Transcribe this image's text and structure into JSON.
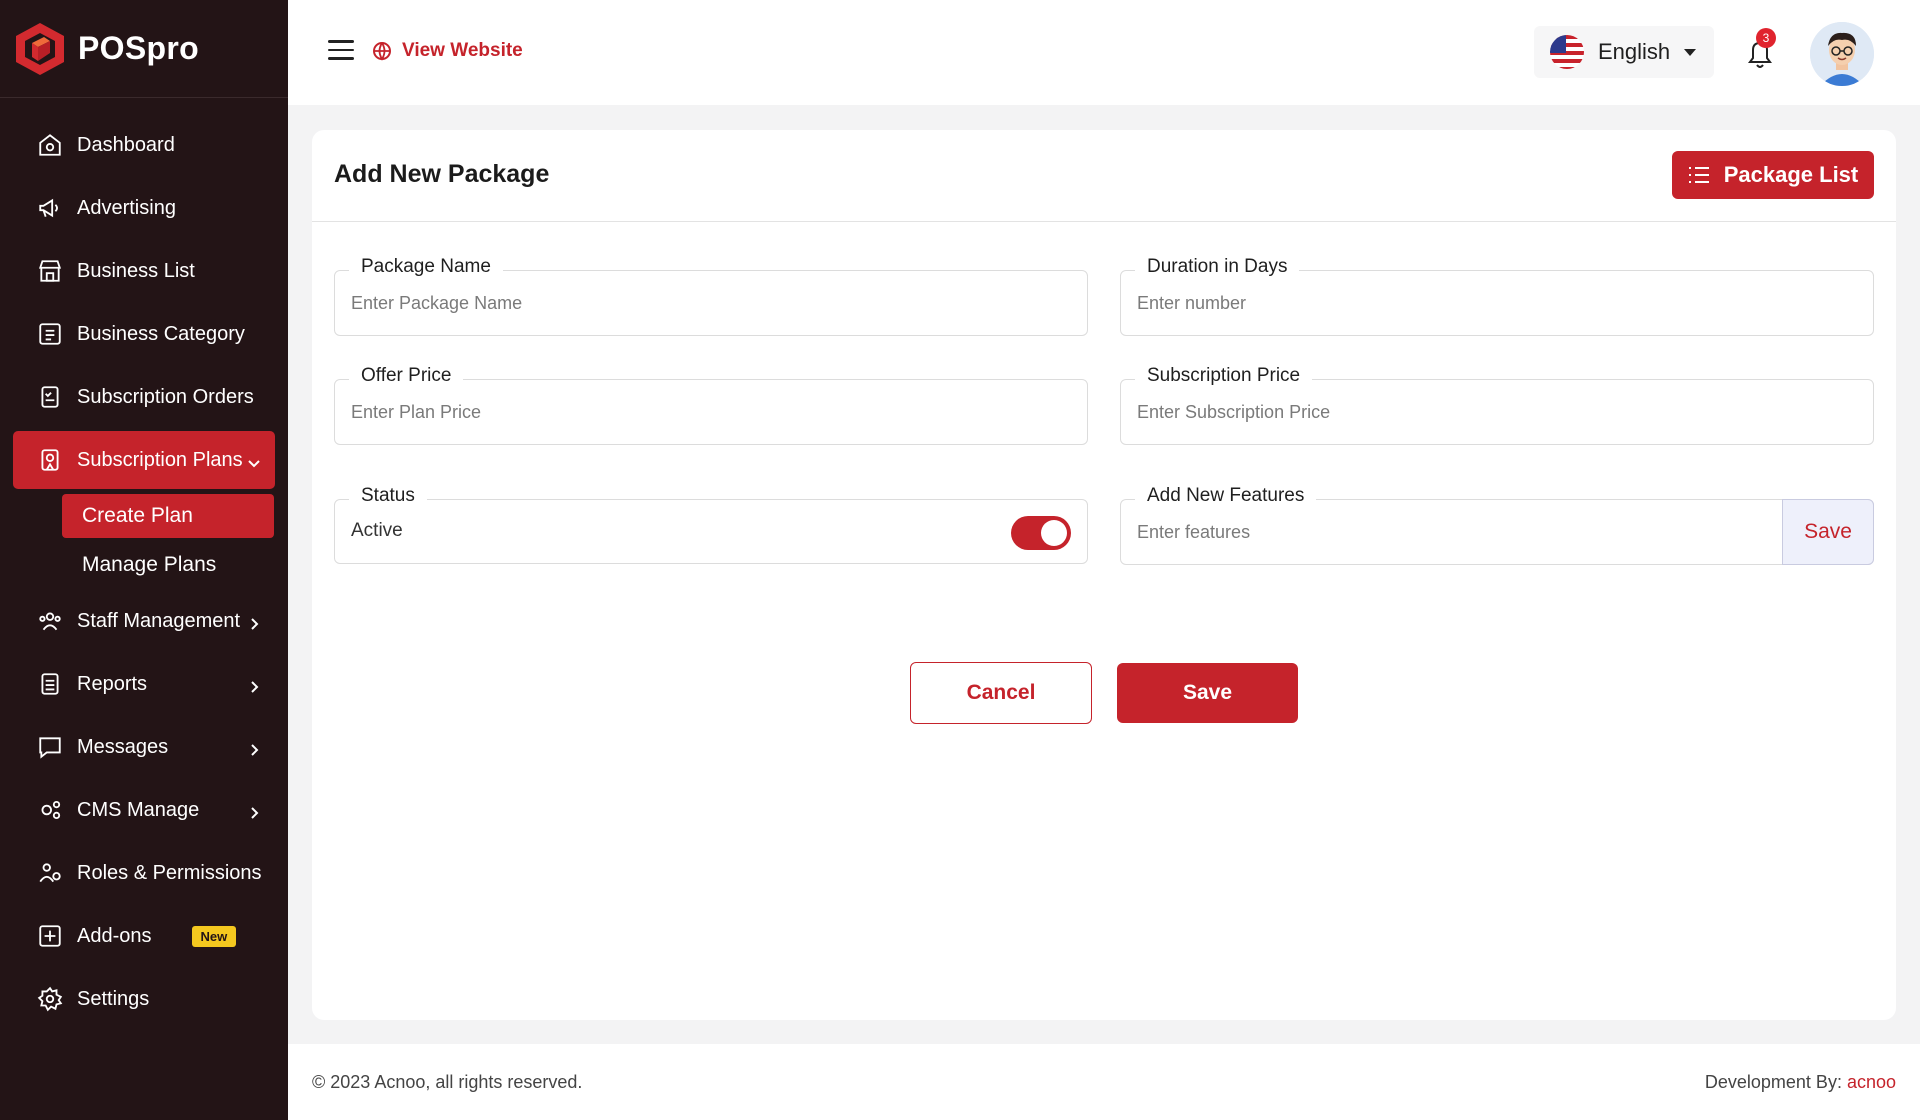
{
  "brand": {
    "name": "POSpro"
  },
  "sidebar": {
    "items": [
      {
        "label": "Dashboard",
        "icon": "home-icon"
      },
      {
        "label": "Advertising",
        "icon": "megaphone-icon"
      },
      {
        "label": "Business List",
        "icon": "store-icon"
      },
      {
        "label": "Business Category",
        "icon": "category-icon"
      },
      {
        "label": "Subscription Orders",
        "icon": "orders-icon"
      },
      {
        "label": "Subscription Plans",
        "icon": "plans-icon",
        "active": true
      },
      {
        "label": "Staff Management",
        "icon": "staff-icon"
      },
      {
        "label": "Reports",
        "icon": "reports-icon"
      },
      {
        "label": "Messages",
        "icon": "messages-icon"
      },
      {
        "label": "CMS Manage",
        "icon": "cms-icon"
      },
      {
        "label": "Roles & Permissions",
        "icon": "roles-icon"
      },
      {
        "label": "Add-ons",
        "icon": "addons-icon",
        "badge": "New"
      },
      {
        "label": "Settings",
        "icon": "settings-icon"
      }
    ],
    "subitems": [
      {
        "label": "Create Plan",
        "active": true
      },
      {
        "label": "Manage Plans"
      }
    ]
  },
  "topbar": {
    "view_website": "View Website",
    "language": "English",
    "notification_count": "3"
  },
  "card": {
    "title": "Add New Package",
    "package_list_label": "Package List"
  },
  "form": {
    "package_name": {
      "label": "Package Name",
      "placeholder": "Enter Package Name"
    },
    "duration": {
      "label": "Duration in Days",
      "placeholder": "Enter number"
    },
    "offer_price": {
      "label": "Offer Price",
      "placeholder": "Enter Plan Price"
    },
    "subscription_price": {
      "label": "Subscription Price",
      "placeholder": "Enter Subscription Price"
    },
    "status": {
      "label": "Status",
      "value": "Active",
      "enabled": true
    },
    "features": {
      "label": "Add New Features",
      "placeholder": "Enter features",
      "save_label": "Save"
    },
    "cancel_label": "Cancel",
    "save_label": "Save"
  },
  "footer": {
    "copyright": "© 2023 Acnoo, all rights reserved.",
    "dev_prefix": "Development By: ",
    "dev_name": "acnoo"
  },
  "colors": {
    "accent": "#c5232b",
    "sidebar_bg": "#231416",
    "badge": "#f4c81f"
  }
}
